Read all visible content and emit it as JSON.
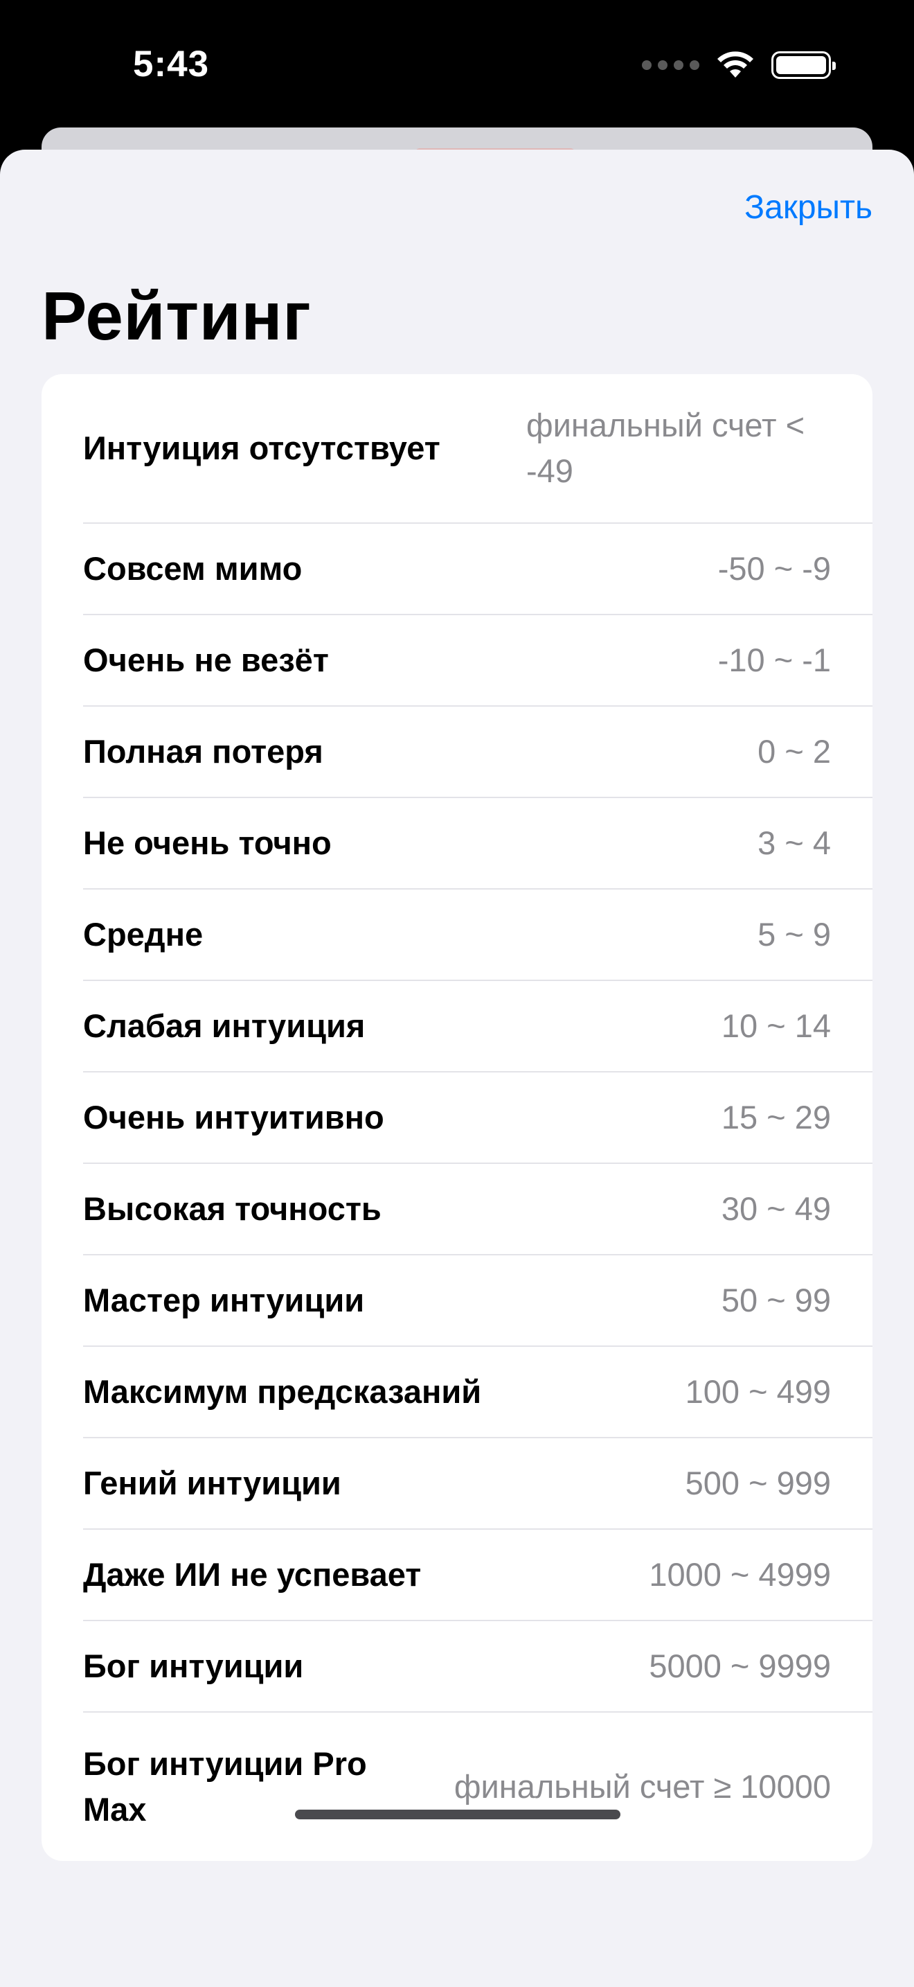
{
  "status_bar": {
    "time": "5:43",
    "icons": [
      "signal-dots-icon",
      "wifi-icon",
      "battery-icon"
    ]
  },
  "sheet": {
    "close_label": "Закрыть",
    "title": "Рейтинг"
  },
  "ratings": [
    {
      "label": "Интуиция отсутствует",
      "range": "финальный счет < -49"
    },
    {
      "label": "Совсем мимо",
      "range": "-50 ~ -9"
    },
    {
      "label": "Очень не везёт",
      "range": "-10 ~ -1"
    },
    {
      "label": "Полная потеря",
      "range": "0 ~ 2"
    },
    {
      "label": "Не очень точно",
      "range": "3 ~ 4"
    },
    {
      "label": "Средне",
      "range": "5 ~ 9"
    },
    {
      "label": "Слабая интуиция",
      "range": "10 ~ 14"
    },
    {
      "label": "Очень интуитивно",
      "range": "15 ~ 29"
    },
    {
      "label": "Высокая точность",
      "range": "30 ~ 49"
    },
    {
      "label": "Мастер интуиции",
      "range": "50 ~ 99"
    },
    {
      "label": "Максимум предсказаний",
      "range": "100 ~ 499"
    },
    {
      "label": "Гений интуиции",
      "range": "500 ~ 999"
    },
    {
      "label": "Даже ИИ не успевает",
      "range": "1000 ~ 4999"
    },
    {
      "label": "Бог интуиции",
      "range": "5000 ~ 9999"
    },
    {
      "label": "Бог интуиции Pro Max",
      "range": "финальный счет ≥ 10000"
    }
  ],
  "colors": {
    "accent": "#007aff",
    "sheet_background": "#f2f2f7",
    "card_background": "#ffffff",
    "secondary_text": "#8a8a8e"
  }
}
